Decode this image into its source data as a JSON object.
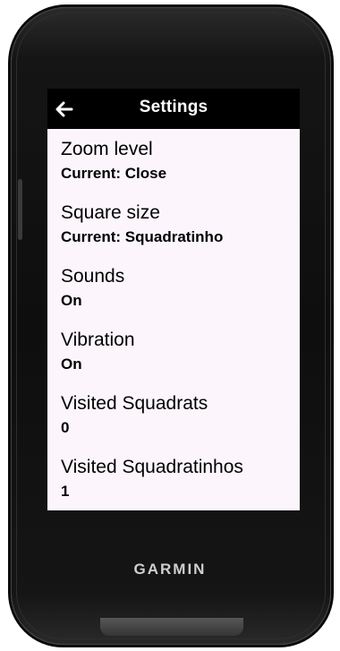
{
  "device": {
    "brand": "GARMIN"
  },
  "header": {
    "back_icon": "arrow-left-icon",
    "title": "Settings"
  },
  "settings": {
    "items": [
      {
        "label": "Zoom level",
        "value": "Current: Close"
      },
      {
        "label": "Square size",
        "value": "Current: Squadratinho"
      },
      {
        "label": "Sounds",
        "value": "On"
      },
      {
        "label": "Vibration",
        "value": "On"
      },
      {
        "label": "Visited Squadrats",
        "value": "0"
      },
      {
        "label": "Visited Squadratinhos",
        "value": "1"
      }
    ]
  },
  "colors": {
    "list_background": "#fcf6fc",
    "header_background": "#000000",
    "text": "#000000"
  }
}
